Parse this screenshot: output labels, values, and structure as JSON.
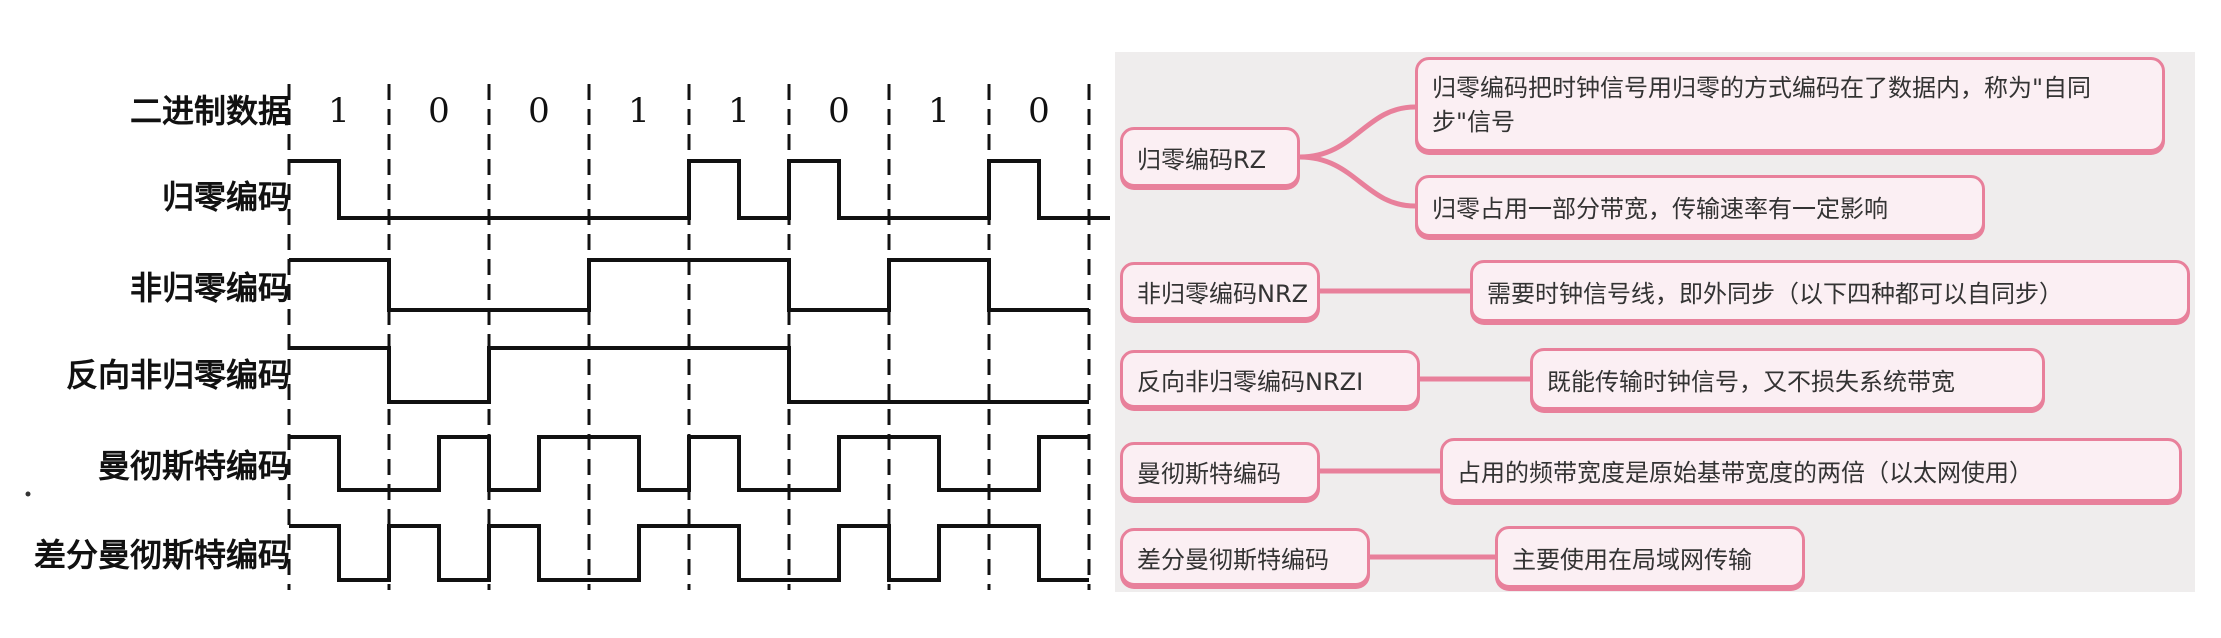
{
  "diagram": {
    "bits": [
      "1",
      "0",
      "0",
      "1",
      "1",
      "0",
      "1",
      "0"
    ],
    "row_labels": [
      "二进制数据",
      "归零编码",
      "非归零编码",
      "反向非归零编码",
      "曼彻斯特编码",
      "差分曼彻斯特编码"
    ],
    "line_color": "#111111",
    "signals": {
      "rz": [
        1,
        0,
        0,
        0,
        0,
        0,
        0,
        0,
        1,
        0,
        1,
        0,
        0,
        0,
        1,
        0,
        0,
        0
      ],
      "nrz": [
        1,
        0,
        0,
        1,
        1,
        0,
        1,
        0
      ],
      "nrzi": [
        1,
        0,
        1,
        1,
        1,
        0,
        0,
        0
      ],
      "manchester": [
        1,
        0,
        0,
        1,
        0,
        1,
        1,
        0,
        1,
        0,
        0,
        1,
        1,
        0,
        0,
        1
      ],
      "diff_manchester": [
        1,
        0,
        1,
        0,
        1,
        0,
        0,
        1,
        1,
        0,
        0,
        1,
        0,
        1,
        1,
        0
      ]
    }
  },
  "mindmap": {
    "accent": "#e8809b",
    "panel_bg": "#efeded",
    "nodes": [
      {
        "name": "归零编码RZ",
        "notes": [
          "归零编码把时钟信号用归零的方式编码在了数据内，称为\"自同步\"信号",
          "归零占用一部分带宽，传输速率有一定影响"
        ]
      },
      {
        "name": "非归零编码NRZ",
        "notes": [
          "需要时钟信号线，即外同步（以下四种都可以自同步）"
        ]
      },
      {
        "name": "反向非归零编码NRZI",
        "notes": [
          "既能传输时钟信号，又不损失系统带宽"
        ]
      },
      {
        "name": "曼彻斯特编码",
        "notes": [
          "占用的频带宽度是原始基带宽度的两倍（以太网使用）"
        ]
      },
      {
        "name": "差分曼彻斯特编码",
        "notes": [
          "主要使用在局域网传输"
        ]
      }
    ]
  }
}
